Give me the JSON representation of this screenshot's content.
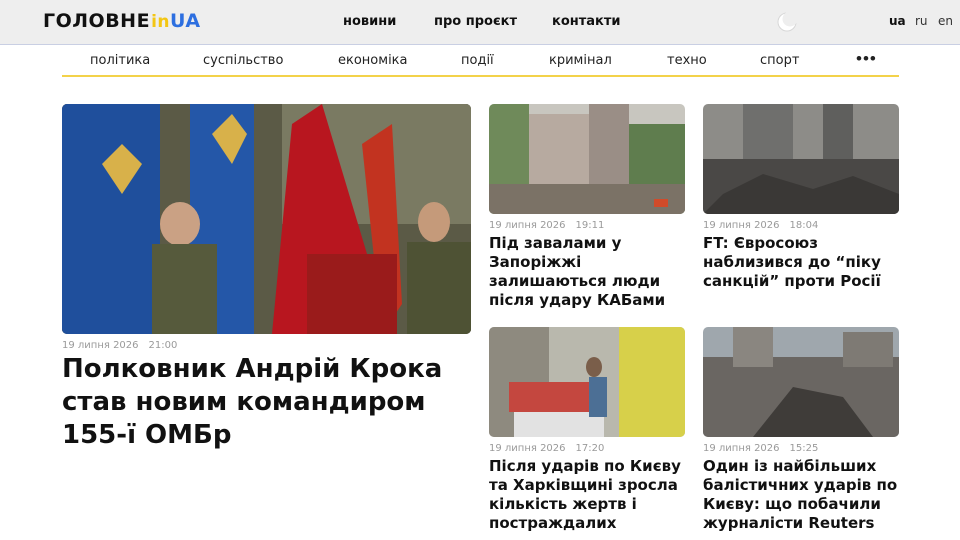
{
  "header": {
    "logo": {
      "main": "ГОЛОВНЕ",
      "in": "in",
      "ua": "UA"
    },
    "nav": [
      "новини",
      "про проєкт",
      "контакти"
    ],
    "theme_toggle_icon": "moon-icon",
    "languages": [
      "ua",
      "ru",
      "en"
    ],
    "active_language": "ua"
  },
  "categories": [
    "політика",
    "суспільство",
    "економіка",
    "події",
    "кримінал",
    "техно",
    "спорт"
  ],
  "more_icon": "more-dots-icon",
  "colors": {
    "accent_yellow": "#f3c614",
    "accent_blue": "#2d6fe0",
    "divider": "#f3d24a"
  },
  "featured": {
    "date": "19 липня 2026",
    "time": "21:00",
    "title": "Полковник Андрій Крока став новим командиром 155-ї ОМБр"
  },
  "articles": [
    {
      "date": "19 липня 2026",
      "time": "19:11",
      "title": "Під завалами у Запоріжжі залишаються люди після удару КАБами"
    },
    {
      "date": "19 липня 2026",
      "time": "18:04",
      "title": "FT: Євросоюз наблизився до “піку санкцій” проти Росії"
    },
    {
      "date": "19 липня 2026",
      "time": "17:20",
      "title": "Після ударів по Києву та Харківщині зросла кількість жертв і постраждалих"
    },
    {
      "date": "19 липня 2026",
      "time": "15:25",
      "title": "Один із найбільших балістичних ударів по Києву: що побачили журналісти Reuters"
    }
  ]
}
